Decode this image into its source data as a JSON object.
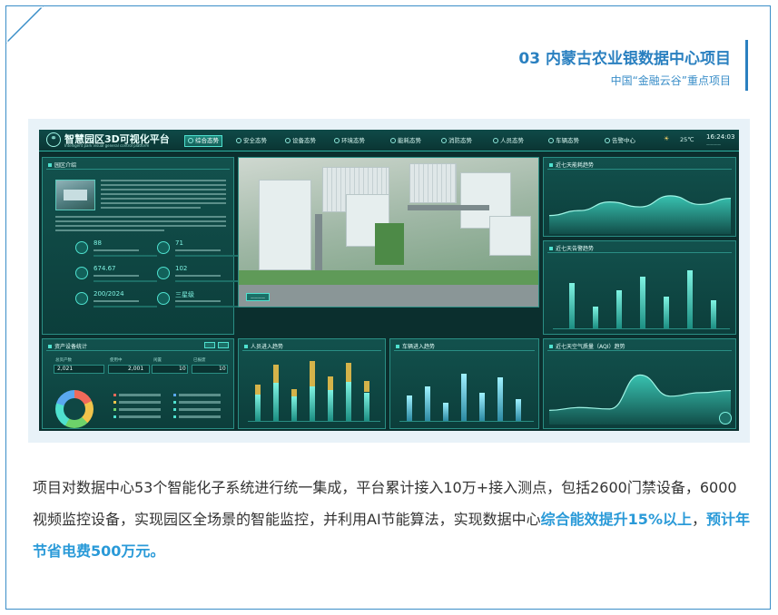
{
  "header": {
    "title": "03 内蒙古农业银数据中心项目",
    "subtitle": "中国“金融云谷”重点项目"
  },
  "dashboard": {
    "title": "智慧园区3D可视化平台",
    "title_en": "Intelligent park visual general control platform",
    "tabs": [
      "综合态势",
      "安全态势",
      "设备态势",
      "环境态势",
      "能耗态势",
      "消防态势",
      "人员态势",
      "车辆态势",
      "告警中心"
    ],
    "temperature": "25℃",
    "time": "16:24:03",
    "panels": {
      "intro": "园区介绍",
      "assets": "资产设备统计",
      "power_trend": "近七天能耗趋势",
      "weekly": "近七天告警趋势",
      "people": "人员进入趋势",
      "vehicle": "车辆进入趋势",
      "aqi": "近七天空气质量（AQI）趋势"
    },
    "stats": [
      {
        "value": "88"
      },
      {
        "value": "71"
      },
      {
        "value": "674.67"
      },
      {
        "value": "102"
      },
      {
        "value": "200/2024"
      },
      {
        "value": "三星级"
      }
    ],
    "assets_numbers": {
      "total_label": "总资产数",
      "total_value": "2,021",
      "inuse_label": "使用中",
      "inuse_value": "2,001",
      "idle_label": "闲置",
      "idle_value": "10",
      "scrap_label": "已报废",
      "scrap_value": "10"
    }
  },
  "chart_data": [
    {
      "type": "bar",
      "panel": "近七天告警趋势",
      "values": [
        72,
        35,
        60,
        82,
        50,
        92,
        44
      ]
    },
    {
      "type": "bar",
      "panel": "人员进入趋势",
      "series": [
        {
          "values": [
            42,
            60,
            38,
            55,
            48,
            62,
            45
          ]
        },
        {
          "values": [
            15,
            28,
            12,
            40,
            22,
            30,
            18
          ]
        }
      ]
    },
    {
      "type": "bar",
      "panel": "车辆进入趋势",
      "values": [
        40,
        55,
        28,
        75,
        45,
        68,
        35
      ]
    },
    {
      "type": "area",
      "panel": "近七天能耗趋势",
      "values": [
        30,
        38,
        52,
        44,
        62,
        48,
        58
      ]
    },
    {
      "type": "area",
      "panel": "近七天空气质量（AQI）趋势",
      "values": [
        20,
        24,
        22,
        70,
        40,
        45,
        48
      ]
    }
  ],
  "body": {
    "text1": "项目对数据中心53个智能化子系统进行统一集成，平台累计接入10万+接入测点，包括2600门禁设备，6000视频监控设备，实现园区全场景的智能监控，并利用AI节能算法，实现数据中心",
    "highlight1": "综合能效提升15%以上",
    "sep": "，",
    "highlight2": "预计年节省电费500万元。"
  },
  "colors": {
    "accent": "#2a80c0",
    "highlight": "#2a9ad8",
    "dashboard_bg": "#0b2f2e",
    "dashboard_accent": "#4fe1cf"
  },
  "icons": [
    "logo-icon",
    "weather-sun-icon",
    "layers-icon"
  ]
}
